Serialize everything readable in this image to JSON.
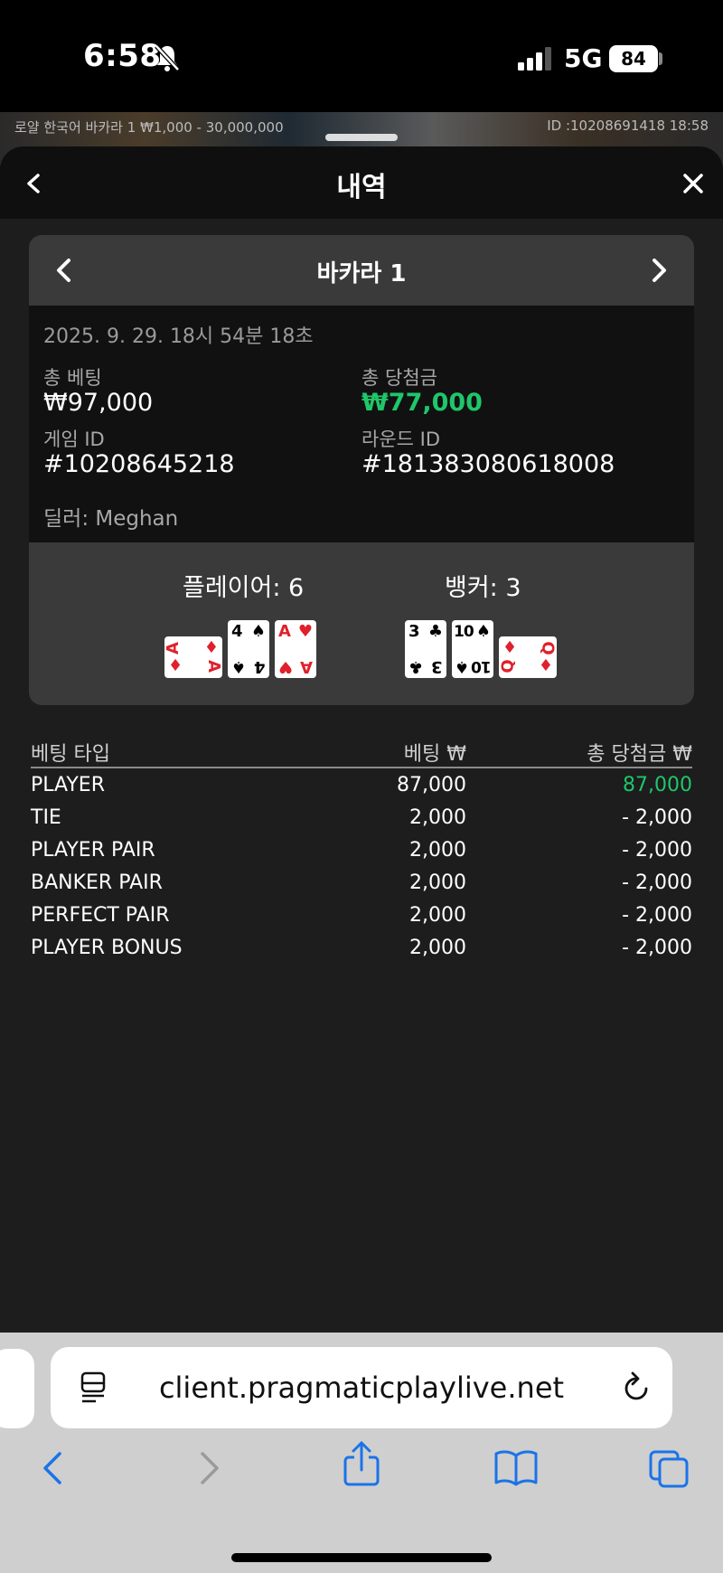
{
  "status": {
    "time": "6:58",
    "network": "5G",
    "battery": "84"
  },
  "game_strip": {
    "left_text": "로얄 한국어 바카라 1 ₩1,000 - 30,000,000",
    "right_text": "ID :10208691418 18:58"
  },
  "modal": {
    "title": "내역"
  },
  "card": {
    "title": "바카라 1",
    "date": "2025. 9. 29. 18시 54분 18초",
    "total_bet_label": "총 베팅",
    "total_bet_value": "₩97,000",
    "total_win_label": "총 당첨금",
    "total_win_value": "₩77,000",
    "game_id_label": "게임 ID",
    "game_id_value": "#10208645218",
    "round_id_label": "라운드 ID",
    "round_id_value": "#181383080618008",
    "dealer": "딜러: Meghan"
  },
  "result": {
    "player_score": "플레이어: 6",
    "banker_score": "뱅커: 3",
    "player_cards": [
      {
        "rank": "A",
        "suit": "♦",
        "color": "#e0202c"
      },
      {
        "rank": "4",
        "suit": "♠",
        "color": "#000000"
      },
      {
        "rank": "A",
        "suit": "♥",
        "color": "#e0202c"
      }
    ],
    "banker_cards": [
      {
        "rank": "3",
        "suit": "♣",
        "color": "#000000"
      },
      {
        "rank": "10",
        "suit": "♠",
        "color": "#000000"
      },
      {
        "rank": "Q",
        "suit": "♦",
        "color": "#e0202c"
      }
    ]
  },
  "bets": {
    "headers": [
      "베팅 타입",
      "베팅 ₩",
      "총 당첨금 ₩"
    ],
    "rows": [
      {
        "type": "PLAYER",
        "bet": "87,000",
        "win": "87,000"
      },
      {
        "type": "TIE",
        "bet": "2,000",
        "win": "- 2,000"
      },
      {
        "type": "PLAYER PAIR",
        "bet": "2,000",
        "win": "- 2,000"
      },
      {
        "type": "BANKER PAIR",
        "bet": "2,000",
        "win": "- 2,000"
      },
      {
        "type": "PERFECT PAIR",
        "bet": "2,000",
        "win": "- 2,000"
      },
      {
        "type": "PLAYER BONUS",
        "bet": "2,000",
        "win": "- 2,000"
      }
    ]
  },
  "browser": {
    "url": "client.pragmaticplaylive.net"
  },
  "colors": {
    "win_green": "#1fc66a",
    "card_red": "#e0202c",
    "ios_blue": "#1a73e8"
  }
}
